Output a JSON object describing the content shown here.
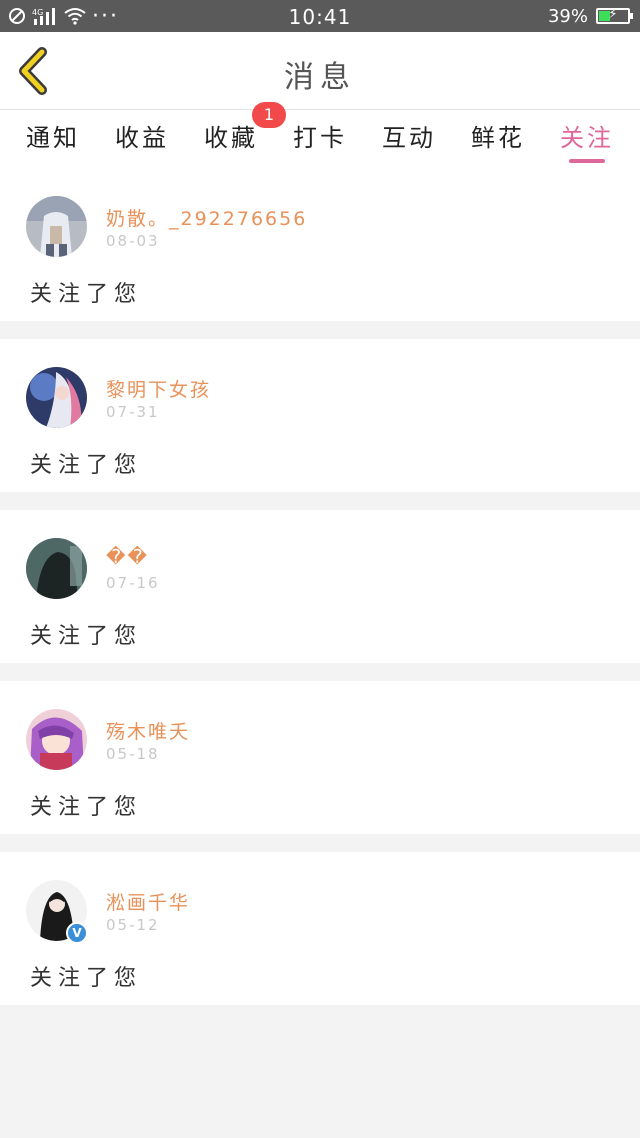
{
  "status_bar": {
    "left_icons": [
      "no-disturb-icon",
      "signal-4g-icon",
      "wifi-icon"
    ],
    "dots": "···",
    "time": "10:41",
    "battery_percent_text": "39%",
    "battery_level": 0.39
  },
  "header": {
    "title": "消息",
    "back_icon": "chevron-left-icon",
    "accent_color": "#f0d020"
  },
  "tabs": [
    {
      "label": "通知"
    },
    {
      "label": "收益"
    },
    {
      "label": "收藏",
      "badge": "1"
    },
    {
      "label": "打卡"
    },
    {
      "label": "互动"
    },
    {
      "label": "鲜花"
    },
    {
      "label": "关注",
      "active": true
    }
  ],
  "items": [
    {
      "name": "奶散。_292276656",
      "date": "08-03",
      "message": "关注了您"
    },
    {
      "name": "黎明下女孩",
      "date": "07-31",
      "message": "关注了您"
    },
    {
      "name": "��",
      "date": "07-16",
      "message": "关注了您"
    },
    {
      "name": "殇木唯夭",
      "date": "05-18",
      "message": "关注了您"
    },
    {
      "name": "淞画千华",
      "date": "05-12",
      "message": "关注了您",
      "verified": "V"
    }
  ],
  "colors": {
    "active_tab": "#e0679a",
    "username": "#e8925a",
    "badge": "#f24a4a"
  }
}
